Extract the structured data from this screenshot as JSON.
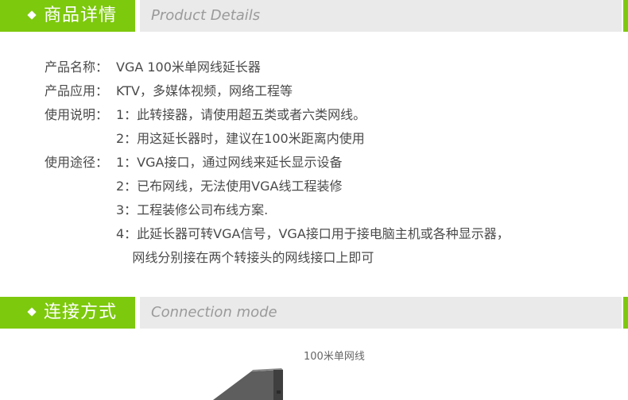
{
  "section1": {
    "title_cn": "商品详情",
    "title_en": "Product Details"
  },
  "details": [
    {
      "key": "产品名称：",
      "value": "VGA 100米单网线延长器"
    },
    {
      "key": "产品应用：",
      "value": "KTV，多媒体视频，网络工程等"
    },
    {
      "key": "使用说明：",
      "value": "1：此转接器，请使用超五类或者六类网线。"
    },
    {
      "key": "",
      "value": "2：用这延长器时，建议在100米距离内使用"
    },
    {
      "key": "使用途径：",
      "value": "1：VGA接口，通过网线来延长显示设备"
    },
    {
      "key": "",
      "value": "2：已布网线，无法使用VGA线工程装修"
    },
    {
      "key": "",
      "value": "3：工程装修公司布线方案."
    },
    {
      "key": "",
      "value": "4：此延长器可转VGA信号，VGA接口用于接电脑主机或各种显示器，"
    },
    {
      "key": "",
      "value": "    网线分别接在两个转接头的网线接口上即可"
    }
  ],
  "section2": {
    "title_cn": "连接方式",
    "title_en": "Connection mode"
  },
  "diagram": {
    "caption": "100米单网线"
  }
}
